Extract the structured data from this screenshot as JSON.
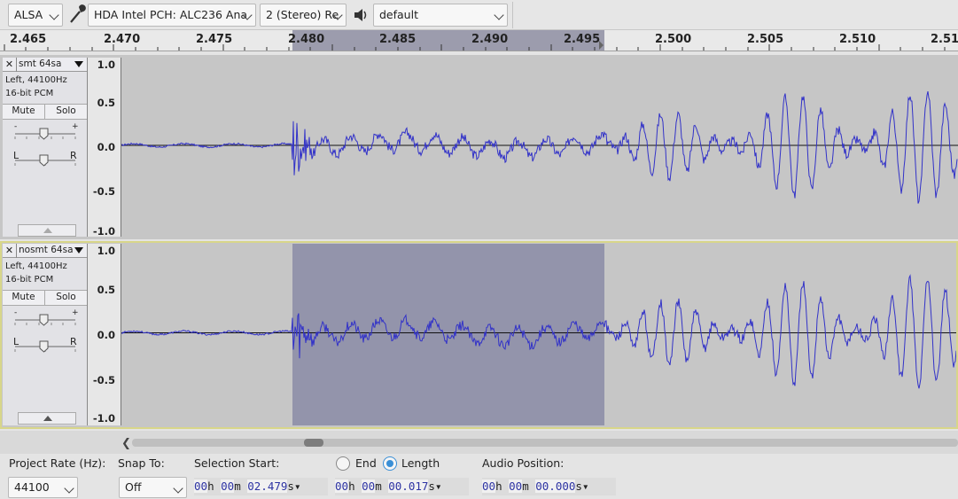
{
  "device_toolbar": {
    "host": "ALSA",
    "recording_device": "HDA Intel PCH: ALC236 Ana",
    "recording_channels": "2 (Stereo) Re",
    "playback_device": "default",
    "icons": [
      "microphone-icon",
      "speaker-icon"
    ]
  },
  "ruler": {
    "labels": [
      "2.465",
      "2.470",
      "2.475",
      "2.480",
      "2.485",
      "2.490",
      "2.495",
      "2.500",
      "2.505",
      "2.510",
      "2.51"
    ]
  },
  "tracks": [
    {
      "name": "smt 64sa",
      "info_line1": "Left, 44100Hz",
      "info_line2": "16-bit PCM",
      "mute": "Mute",
      "solo": "Solo",
      "gain_minus": "-",
      "gain_plus": "+",
      "pan_left": "L",
      "pan_right": "R",
      "scale": [
        "1.0",
        "0.5",
        "0.0",
        "-0.5",
        "-1.0"
      ],
      "selected": false
    },
    {
      "name": "nosmt 64sa",
      "info_line1": "Left, 44100Hz",
      "info_line2": "16-bit PCM",
      "mute": "Mute",
      "solo": "Solo",
      "gain_minus": "-",
      "gain_plus": "+",
      "pan_left": "L",
      "pan_right": "R",
      "scale": [
        "1.0",
        "0.5",
        "0.0",
        "-0.5",
        "-1.0"
      ],
      "selected": true
    }
  ],
  "selection_toolbar": {
    "project_rate_label": "Project Rate (Hz):",
    "project_rate_value": "44100",
    "snap_to_label": "Snap To:",
    "snap_to_value": "Off",
    "selection_start_label": "Selection Start:",
    "end_label": "End",
    "length_label": "Length",
    "length_selected": true,
    "audio_position_label": "Audio Position:",
    "selection_start": {
      "h": "00",
      "m": "00",
      "s": "02.479"
    },
    "selection_length": {
      "h": "00",
      "m": "00",
      "s": "00.017"
    },
    "audio_position": {
      "h": "00",
      "m": "00",
      "s": "00.000"
    },
    "unit_h": "h",
    "unit_m": "m",
    "unit_s": "s"
  },
  "colors": {
    "waveform": "#3232c8",
    "selection": "#9394ab",
    "track_bg": "#c6c6c6",
    "selected_frame": "#d8d68a"
  }
}
